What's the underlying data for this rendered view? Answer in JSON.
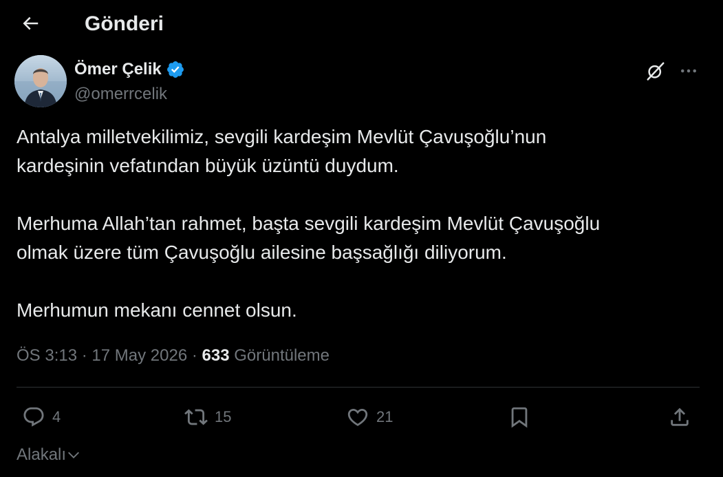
{
  "header": {
    "back_icon": "arrow-left-icon",
    "title": "Gönderi"
  },
  "author": {
    "name": "Ömer Çelik",
    "handle": "@omerrcelik",
    "verified_icon": "verified-badge-icon",
    "verified_color": "#1d9bf0"
  },
  "tweet": {
    "paragraphs": [
      "Antalya milletvekilimiz, sevgili kardeşim Mevlüt Çavuşoğlu’nun\nkardeşinin vefatından büyük üzüntü duydum.",
      "Merhuma Allah’tan rahmet, başta sevgili kardeşim Mevlüt Çavuşoğlu\nolmak üzere tüm Çavuşoğlu ailesine başsağlığı diliyorum.",
      "Merhumun mekanı cennet olsun."
    ]
  },
  "meta": {
    "time": "ÖS 3:13",
    "separator": "·",
    "date": "17 May 2026",
    "views_count": "633",
    "views_label": "Görüntüleme"
  },
  "actions": {
    "reply": {
      "icon": "reply-icon",
      "count": "4"
    },
    "retweet": {
      "icon": "retweet-icon",
      "count": "15"
    },
    "like": {
      "icon": "heart-icon",
      "count": "21"
    },
    "bookmark": {
      "icon": "bookmark-icon"
    },
    "share": {
      "icon": "share-icon"
    }
  },
  "related": {
    "label": "Alakalı",
    "icon": "chevron-down-icon"
  },
  "colors": {
    "background": "#000000",
    "text": "#e7e9ea",
    "muted": "#71767b",
    "border": "#2f3336",
    "accent": "#1d9bf0"
  }
}
